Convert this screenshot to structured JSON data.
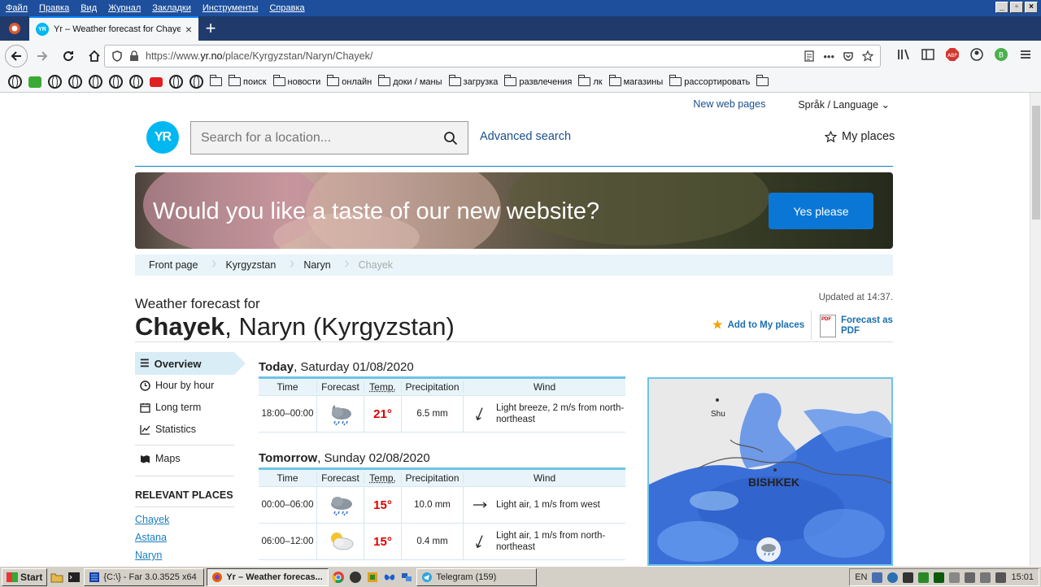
{
  "menubar": {
    "items": [
      "Файл",
      "Правка",
      "Вид",
      "Журнал",
      "Закладки",
      "Инструменты",
      "Справка"
    ],
    "window_buttons": [
      "_",
      "▫",
      "×"
    ]
  },
  "tabs": {
    "active_title": "Yr – Weather forecast for Chayek",
    "favicon_text": "YR",
    "close": "×",
    "new_tab": "+"
  },
  "navbar": {
    "url_prefix": "https://www.",
    "url_domain": "yr.no",
    "url_path": "/place/Kyrgyzstan/Naryn/Chayek/",
    "more": "•••"
  },
  "bookmarks": {
    "folders": [
      "поиск",
      "новости",
      "онлайн",
      "доки / маны",
      "загрузка",
      "развлечения",
      "лк",
      "магазины",
      "рассортировать",
      ""
    ]
  },
  "page": {
    "new_web_pages": "New web pages",
    "language": "Språk / Language",
    "logo_text": "YR",
    "search_placeholder": "Search for a location...",
    "advanced_search": "Advanced search",
    "my_places": "My places",
    "banner_title": "Would you like a taste of our new website?",
    "banner_button": "Yes please",
    "breadcrumb": [
      "Front page",
      "Kyrgyzstan",
      "Naryn",
      "Chayek"
    ],
    "updated": "Updated at 14:37.",
    "forecast_for": "Weather forecast for",
    "place_bold": "Chayek",
    "place_rest": ", Naryn (Kyrgyzstan)",
    "add_to_places": "Add to My places",
    "pdf_line1": "Forecast as",
    "pdf_line2": "PDF",
    "pdf_icon_text": "PDF"
  },
  "sidebar": {
    "overview": "Overview",
    "hour_by_hour": "Hour by hour",
    "long_term": "Long term",
    "statistics": "Statistics",
    "maps": "Maps",
    "relevant_heading": "RELEVANT PLACES",
    "relevant": [
      "Chayek",
      "Astana",
      "Naryn"
    ]
  },
  "forecast": {
    "headers": {
      "time": "Time",
      "forecast": "Forecast",
      "temp": "Temp.",
      "precip": "Precipitation",
      "wind": "Wind"
    },
    "today": {
      "label": "Today",
      "date": ", Saturday 01/08/2020",
      "rows": [
        {
          "time": "18:00–00:00",
          "icon": "cloud-rain-moon-icon",
          "temp": "21°",
          "precip": "6.5 mm",
          "wind": "Light breeze, 2 m/s from north-northeast",
          "wind_from_deg": 22
        }
      ]
    },
    "tomorrow": {
      "label": "Tomorrow",
      "date": ", Sunday 02/08/2020",
      "rows": [
        {
          "time": "00:00–06:00",
          "icon": "cloud-rain-icon",
          "temp": "15°",
          "precip": "10.0 mm",
          "wind": "Light air, 1 m/s from west",
          "wind_from_deg": 270
        },
        {
          "time": "06:00–12:00",
          "icon": "partly-cloudy-icon",
          "temp": "15°",
          "precip": "0.4 mm",
          "wind": "Light air, 1 m/s from north-northeast",
          "wind_from_deg": 22
        }
      ]
    }
  },
  "map": {
    "labels": {
      "shu": "Shu",
      "bishkek": "BISHKEK"
    }
  },
  "taskbar": {
    "start": "Start",
    "tasks": [
      {
        "label": "{C:\\} - Far 3.0.3525 x64",
        "active": false
      },
      {
        "label": "Yr – Weather forecas...",
        "active": true
      },
      {
        "label": "Telegram (159)",
        "active": false
      }
    ],
    "lang": "EN",
    "time": "15:01"
  },
  "colors": {
    "accent": "#00b8f1",
    "link": "#1a4f8b",
    "temp_warm": "#dd0000",
    "banner_button": "#0a77d6"
  }
}
